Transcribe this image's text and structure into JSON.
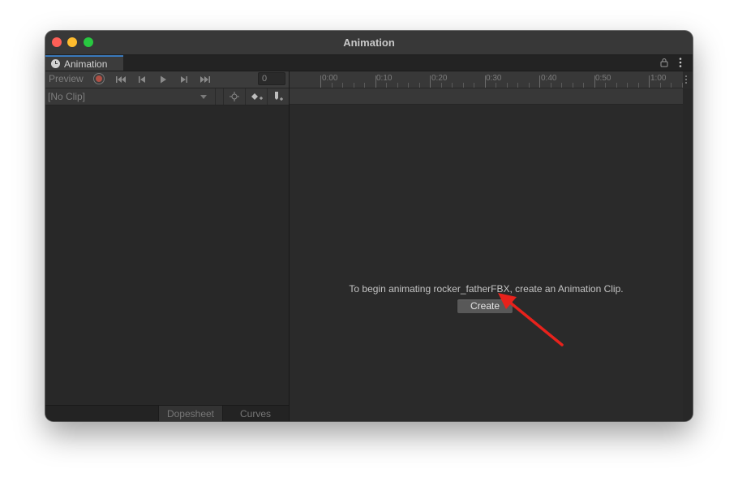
{
  "window": {
    "title": "Animation"
  },
  "tab": {
    "label": "Animation"
  },
  "toolbar": {
    "preview_label": "Preview",
    "frame_value": "0"
  },
  "clip": {
    "selected": "[No Clip]"
  },
  "bottom_tabs": [
    {
      "label": "Dopesheet"
    },
    {
      "label": "Curves"
    }
  ],
  "timeline": {
    "ticks": [
      "0:00",
      "0:10",
      "0:20",
      "0:30",
      "0:40",
      "0:50",
      "1:00"
    ]
  },
  "main": {
    "message": "To begin animating rocker_fatherFBX, create an Animation Clip.",
    "create_label": "Create"
  },
  "colors": {
    "accent": "#3a79bb",
    "record": "#b05045",
    "annotation_arrow": "#e8221c"
  }
}
